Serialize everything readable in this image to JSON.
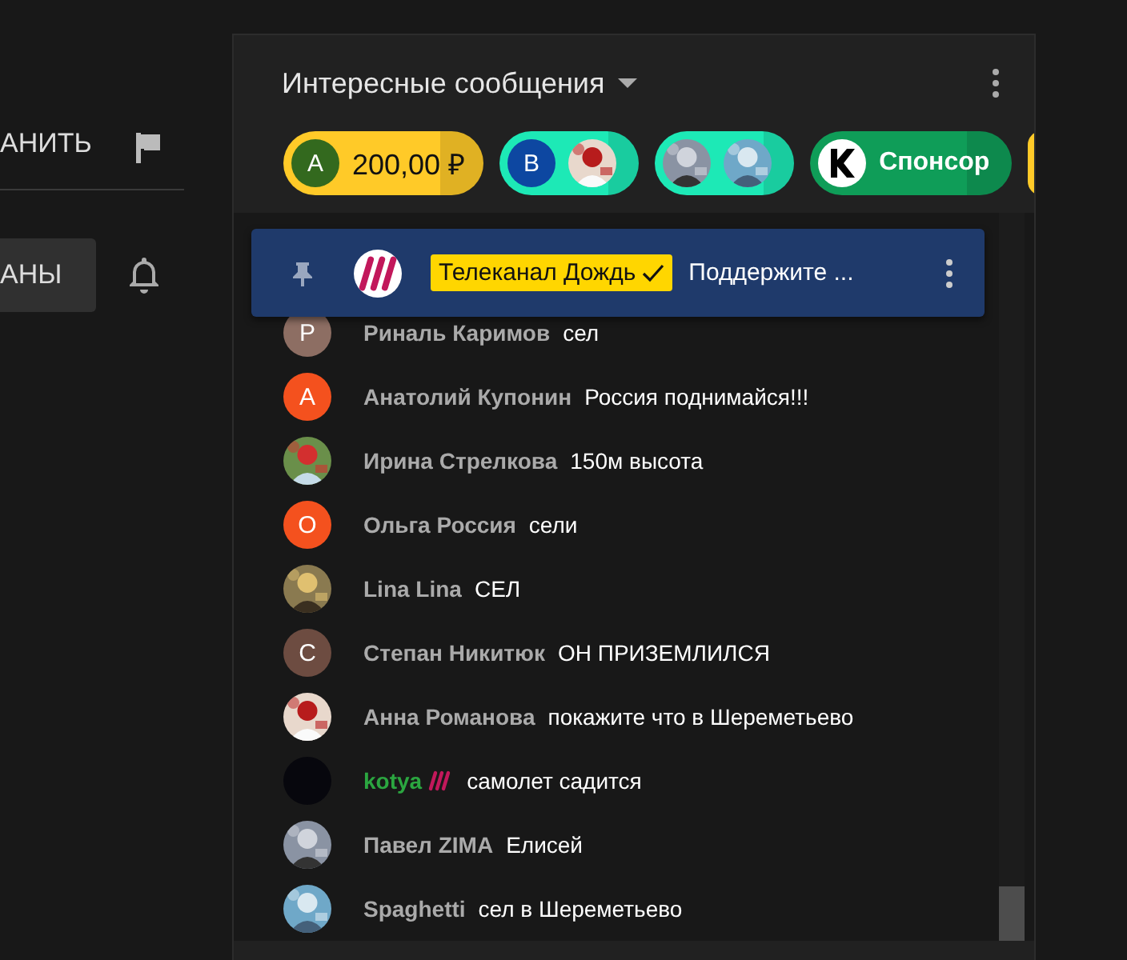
{
  "side": {
    "save_label": "АНИТЬ",
    "subscribe_label": "АНЫ"
  },
  "chat": {
    "title": "Интересные сообщения",
    "chips": [
      {
        "kind": "amount",
        "avatar_letter": "A",
        "text": "200,00 ₽",
        "color": "#ffca28"
      },
      {
        "kind": "sticker",
        "avatar_letter": "B",
        "color": "#1de9b6"
      },
      {
        "kind": "sticker",
        "color": "#1de9b6"
      },
      {
        "kind": "member",
        "text": "Спонсор",
        "color": "#0f9d58"
      },
      {
        "kind": "partial",
        "color": "#ffca28"
      }
    ],
    "pinned": {
      "author": "Телеканал Дождь",
      "text": "Поддержите ...",
      "verified": true
    },
    "messages": [
      {
        "avatar": {
          "kind": "letter",
          "letter": "Р",
          "color": "#8d6e63"
        },
        "name": "Риналь Каримов",
        "text": "сел",
        "member": false
      },
      {
        "avatar": {
          "kind": "letter",
          "letter": "А",
          "color": "#f4511e"
        },
        "name": "Анатолий Купонин",
        "text": "Россия поднимайся!!!",
        "member": false
      },
      {
        "name": "Ирина Стрелкова",
        "text": "150м высота",
        "member": false
      },
      {
        "avatar": {
          "kind": "letter",
          "letter": "О",
          "color": "#f4511e"
        },
        "name": "Ольга Россия",
        "text": "сели",
        "member": false
      },
      {
        "name": "Lina Lina",
        "text": "СЕЛ",
        "member": false
      },
      {
        "avatar": {
          "kind": "letter",
          "letter": "С",
          "color": "#6d4c41"
        },
        "name": "Степан Никитюк",
        "text": "ОН ПРИЗЕМЛИЛСЯ",
        "member": false
      },
      {
        "name": "Анна Романова",
        "text": "покажите что в Шереметьево",
        "member": false
      },
      {
        "avatar": {
          "kind": "plain",
          "color": "#07070d"
        },
        "name": "kotya",
        "text": "самолет садится",
        "member": true
      },
      {
        "name": "Павел ZIMA",
        "text": "Елисей",
        "member": false
      },
      {
        "name": "Spaghetti",
        "text": "сел в Шереметьево",
        "member": false
      }
    ]
  }
}
